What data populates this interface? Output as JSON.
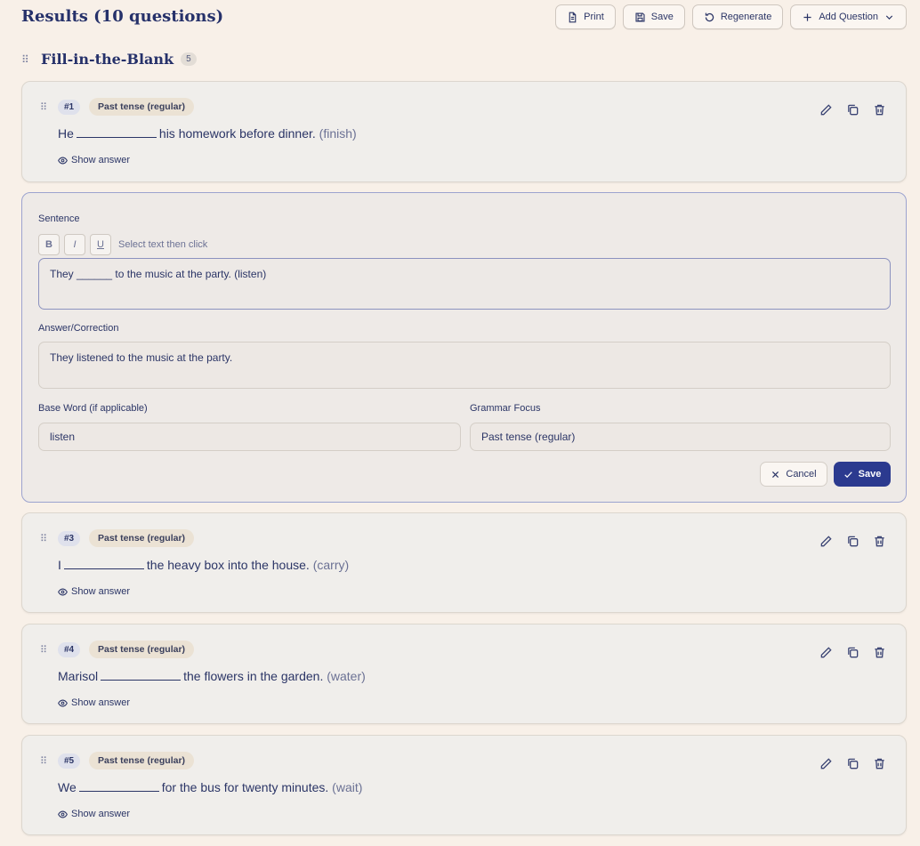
{
  "header": {
    "title": "Results (10 questions)",
    "print_label": "Print",
    "save_label": "Save",
    "regenerate_label": "Regenerate",
    "add_question_label": "Add Question"
  },
  "section": {
    "title": "Fill-in-the-Blank",
    "count": "5"
  },
  "questions": [
    {
      "num": "#1",
      "tag": "Past tense (regular)",
      "before": "He",
      "after": "his homework before dinner.",
      "base": "(finish)",
      "show_answer": "Show answer"
    },
    {
      "num": "#3",
      "tag": "Past tense (regular)",
      "before": "I",
      "after": "the heavy box into the house.",
      "base": "(carry)",
      "show_answer": "Show answer"
    },
    {
      "num": "#4",
      "tag": "Past tense (regular)",
      "before": "Marisol",
      "after": "the flowers in the garden.",
      "base": "(water)",
      "show_answer": "Show answer"
    },
    {
      "num": "#5",
      "tag": "Past tense (regular)",
      "before": "We",
      "after": "for the bus for twenty minutes.",
      "base": "(wait)",
      "show_answer": "Show answer"
    }
  ],
  "editor": {
    "sentence_label": "Sentence",
    "bold": "B",
    "italic": "I",
    "underline": "U",
    "format_hint": "Select text then click",
    "sentence_value": "They ______ to the music at the party. (listen)",
    "answer_label": "Answer/Correction",
    "answer_value": "They listened to the music at the party.",
    "base_label": "Base Word (if applicable)",
    "base_value": "listen",
    "focus_label": "Grammar Focus",
    "focus_value": "Past tense (regular)",
    "cancel_label": "Cancel",
    "save_label": "Save"
  }
}
